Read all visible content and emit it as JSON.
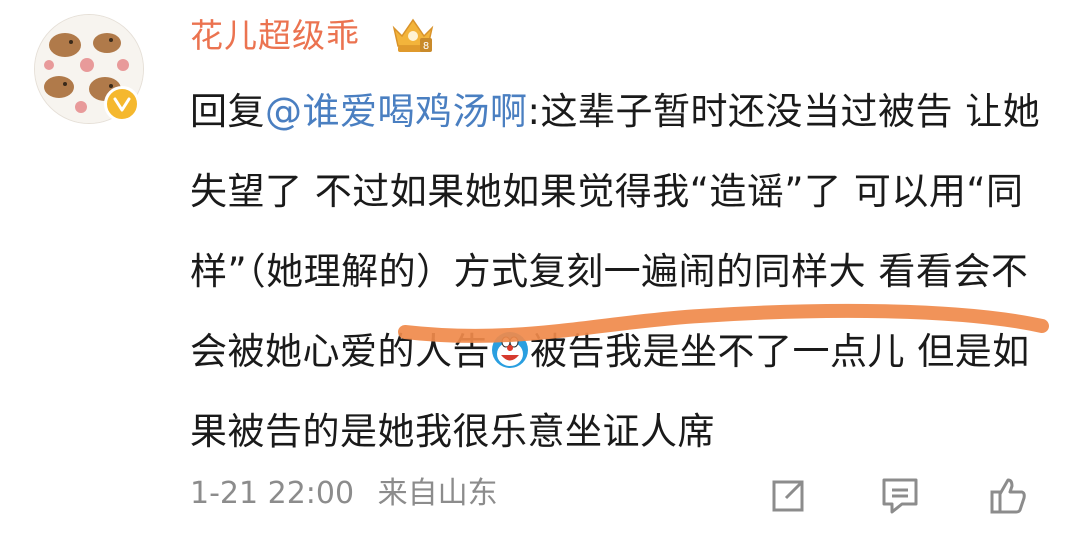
{
  "comment": {
    "username": "花儿超级乖",
    "reply_prefix": "回复",
    "mention": "@谁爱喝鸡汤啊",
    "separator": ":",
    "body_part1": "这辈子暂时还没当过被告 让她失望了 不过如果她如果觉得我“造谣”了 可以用“同样”（她理解的）方式复刻一遍闹的同样大 看看会不会被她心爱的人告",
    "body_part2": "被告我是坐不了一点儿 但是如果被告的是她我很乐意坐证人席",
    "timestamp": "1-21 22:00",
    "location": "来自山东"
  },
  "icons": {
    "avatar": "capybara-pattern-avatar",
    "verified": "verified-badge-icon",
    "vip": "crown-vip-badge-icon",
    "emoji": "doraemon-emoji",
    "share": "share-icon",
    "reply": "comment-icon",
    "like": "thumbs-up-icon"
  },
  "colors": {
    "username": "#eb7350",
    "mention": "#4a7fc1",
    "highlight_stroke": "#f08a4b",
    "meta": "#8c8c8c"
  }
}
